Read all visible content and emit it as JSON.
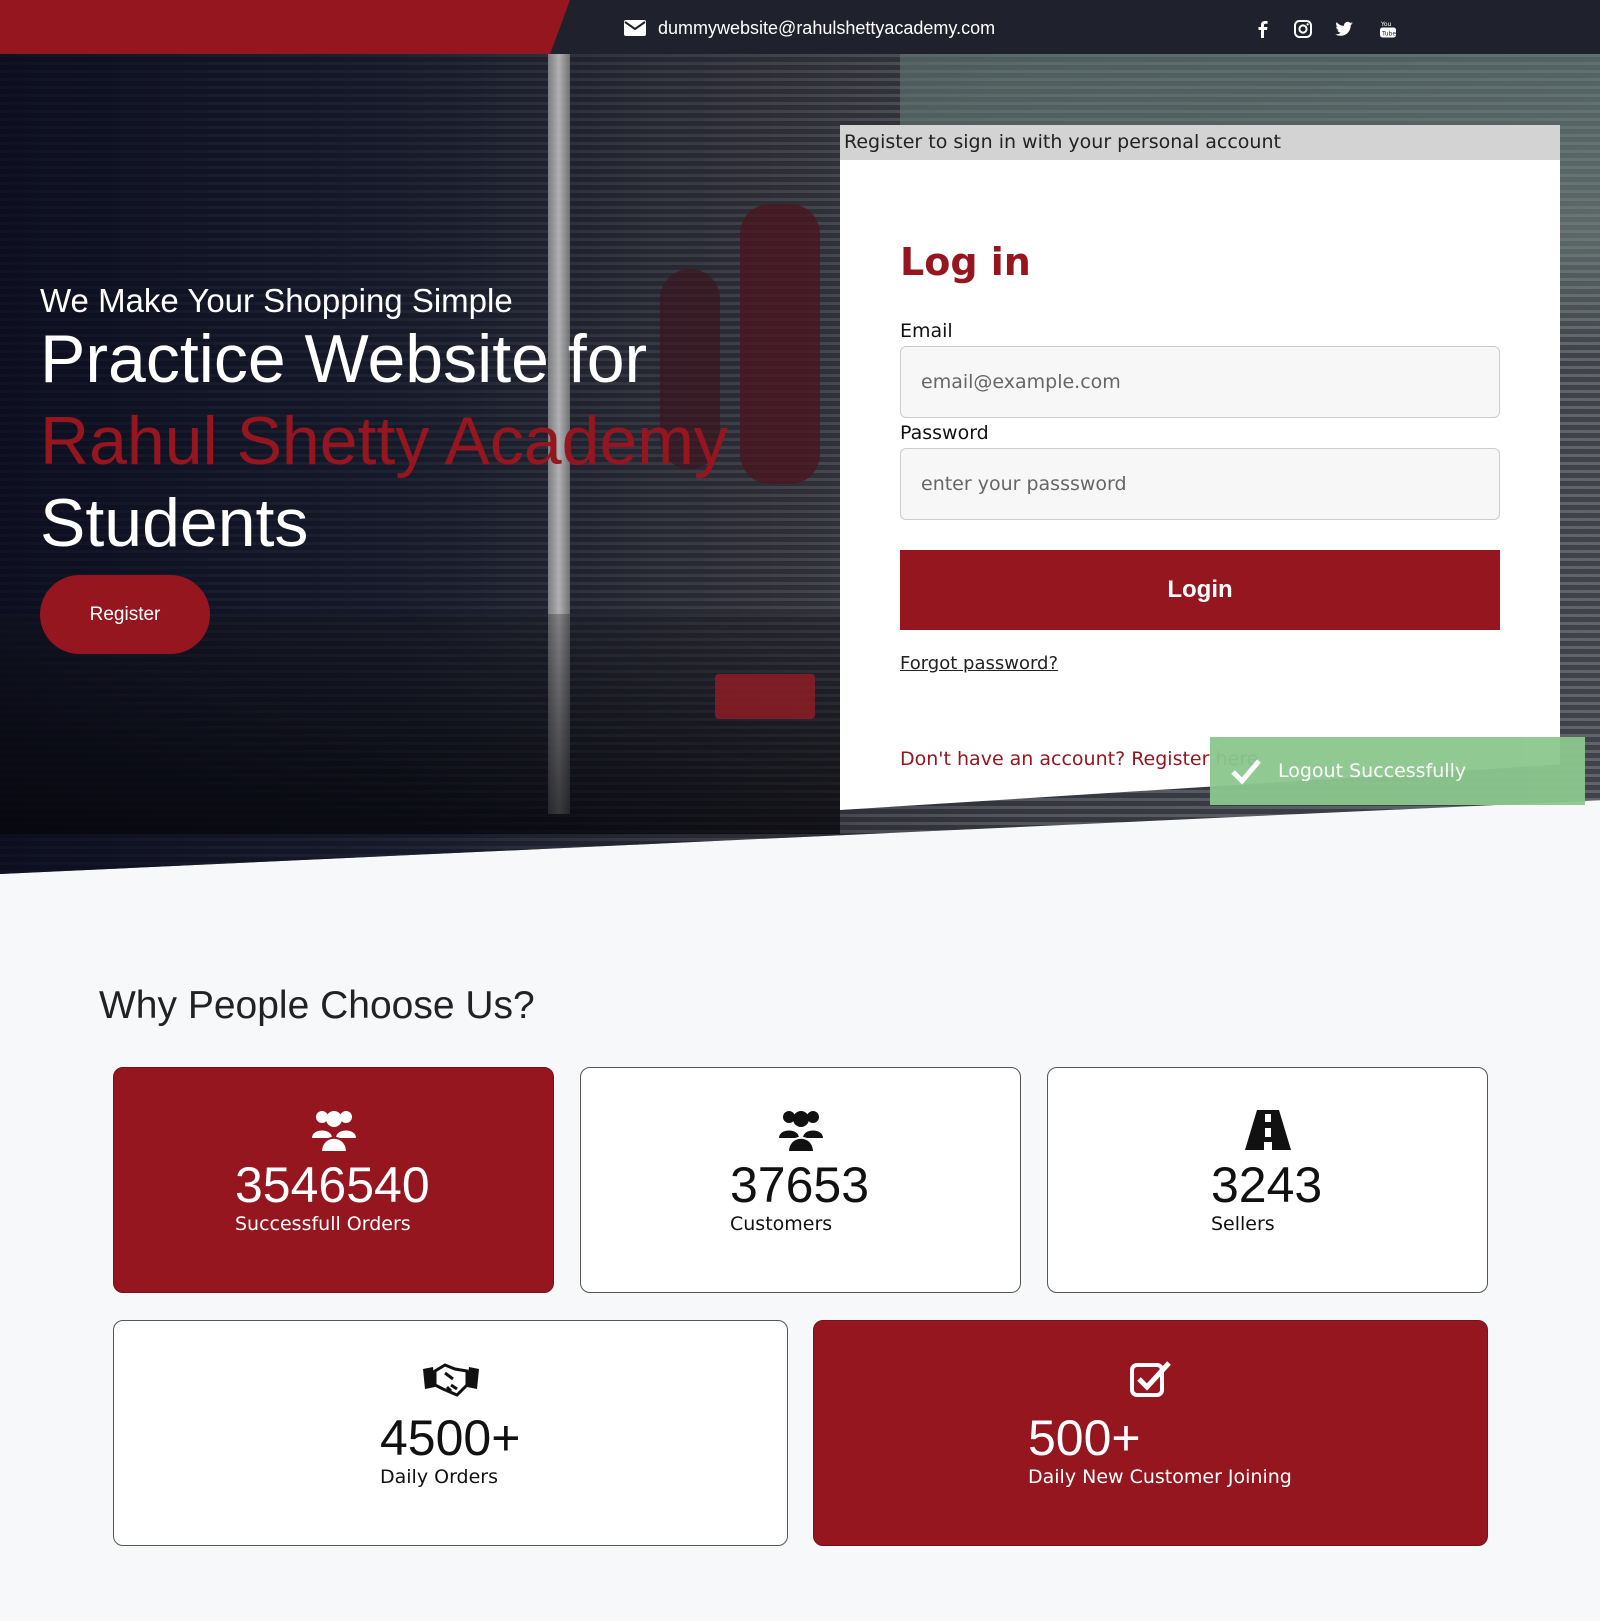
{
  "topbar": {
    "email": "dummywebsite@rahulshettyacademy.com",
    "social_icons": [
      "facebook-icon",
      "instagram-icon",
      "twitter-icon",
      "youtube-icon"
    ]
  },
  "hero": {
    "subtitle": "We Make Your Shopping Simple",
    "title_line1": "Practice Website for",
    "title_highlight": "Rahul Shetty Academy",
    "title_line3": "Students",
    "register_label": "Register"
  },
  "login": {
    "card_header": "Register to sign in with your personal account",
    "title": "Log in",
    "email_label": "Email",
    "email_placeholder": "email@example.com",
    "password_label": "Password",
    "password_placeholder": "enter your passsword",
    "login_button": "Login",
    "forgot_link": "Forgot password?",
    "register_link": "Don't have an account? Register here"
  },
  "toast": {
    "message": "Logout Successfully"
  },
  "why": {
    "title": "Why People Choose Us?",
    "stats": [
      {
        "icon": "users-icon",
        "value": "3546540",
        "label": "Successfull Orders"
      },
      {
        "icon": "users-icon",
        "value": "37653",
        "label": "Customers"
      },
      {
        "icon": "road-icon",
        "value": "3243",
        "label": "Sellers"
      },
      {
        "icon": "handshake-icon",
        "value": "4500+",
        "label": "Daily Orders"
      },
      {
        "icon": "check-square-icon",
        "value": "500+",
        "label": "Daily New Customer Joining"
      }
    ]
  },
  "colors": {
    "brand_red": "#961620",
    "dark": "#1f222c",
    "toast_green": "#8bc78d",
    "background": "#f7f8fa"
  }
}
